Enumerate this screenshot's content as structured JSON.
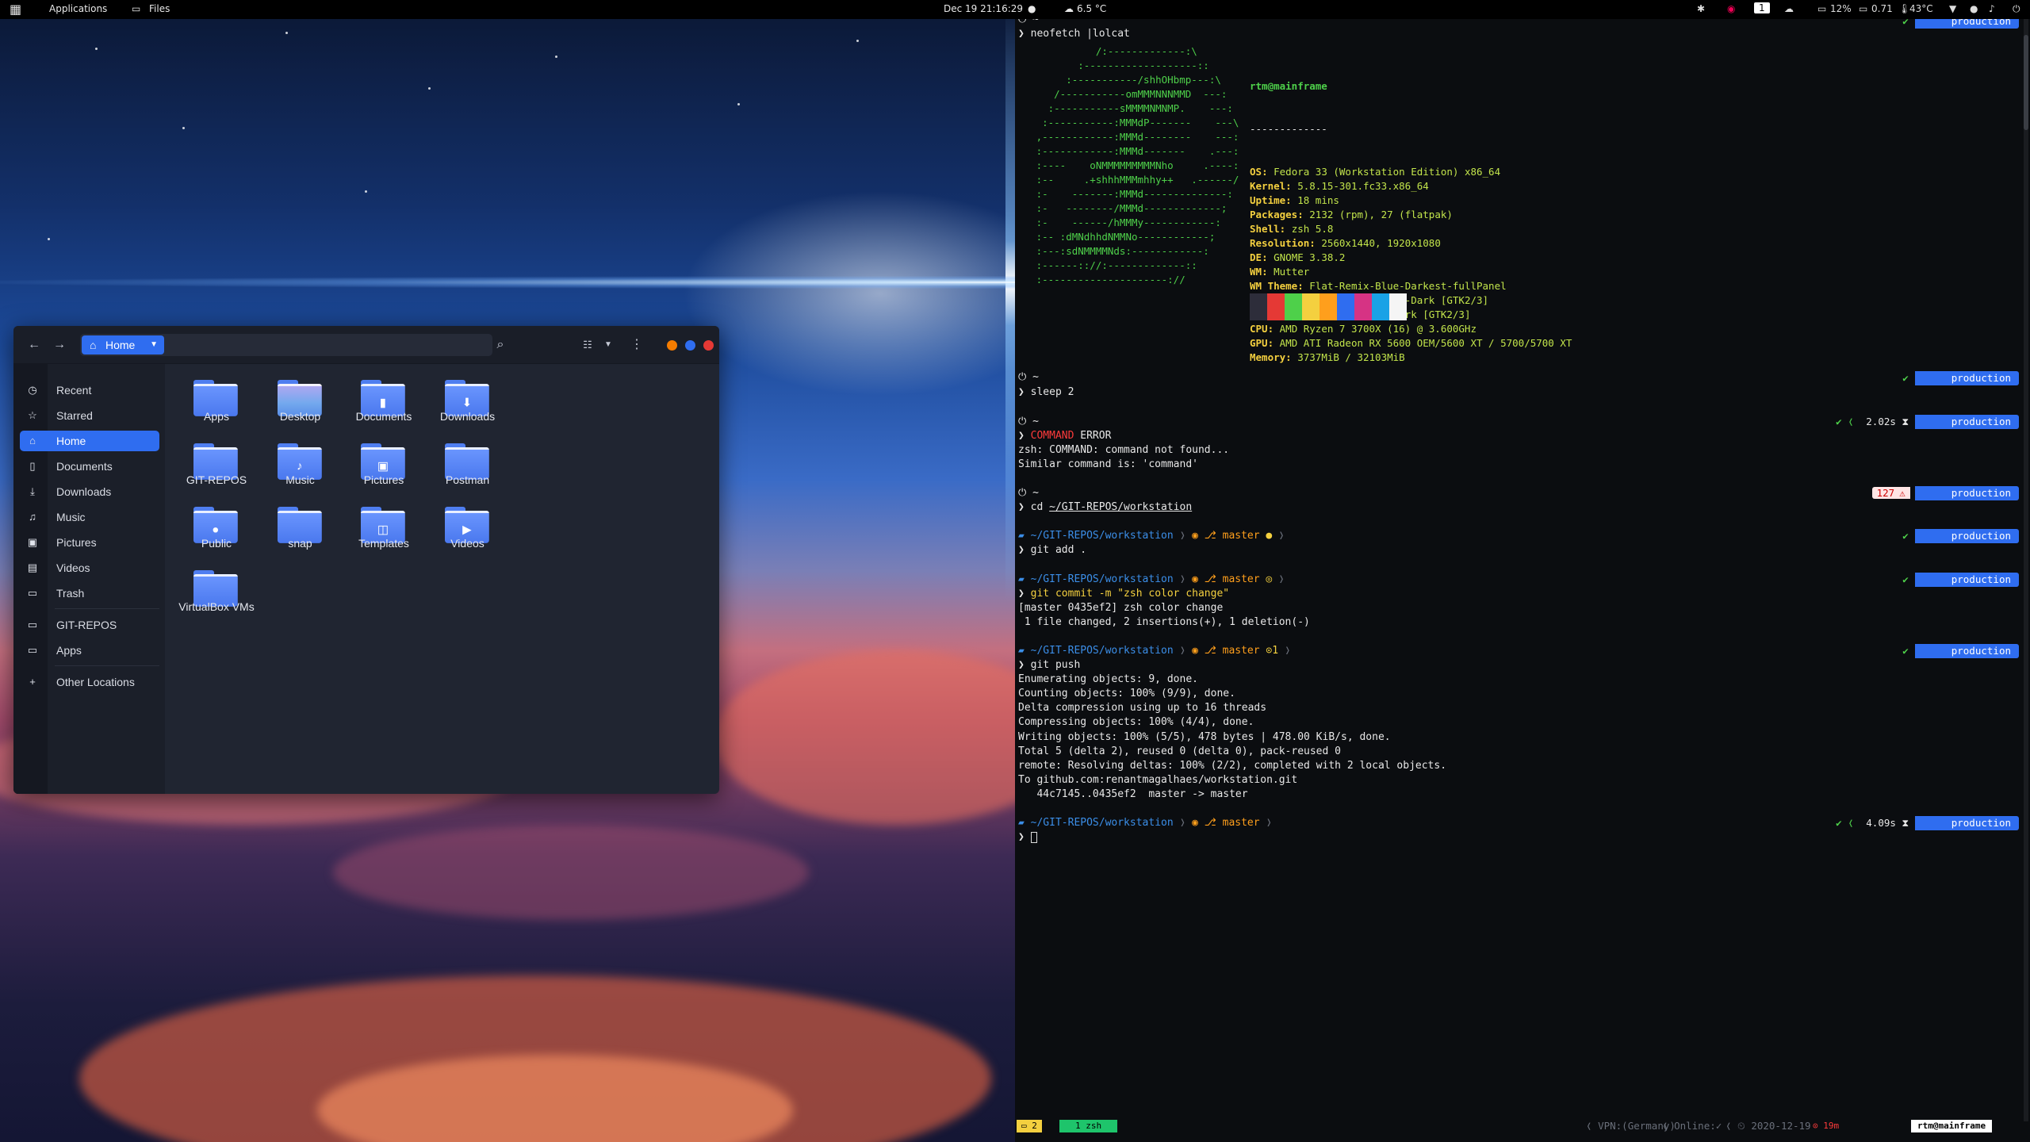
{
  "topbar": {
    "applications": "Applications",
    "files": "Files",
    "clock": "Dec 19  21:16:29",
    "weather": "6.5 °C",
    "workspace": "1",
    "cpu": "12%",
    "load": "0.71",
    "temp": "43°C"
  },
  "filemanager": {
    "path": "Home",
    "sidebar": [
      {
        "label": "Recent",
        "icon": "clock-icon"
      },
      {
        "label": "Starred",
        "icon": "star-icon"
      },
      {
        "label": "Home",
        "icon": "home-icon"
      },
      {
        "label": "Documents",
        "icon": "document-icon"
      },
      {
        "label": "Downloads",
        "icon": "download-icon"
      },
      {
        "label": "Music",
        "icon": "music-icon"
      },
      {
        "label": "Pictures",
        "icon": "picture-icon"
      },
      {
        "label": "Videos",
        "icon": "video-icon"
      },
      {
        "label": "Trash",
        "icon": "trash-icon"
      },
      {
        "label": "GIT-REPOS",
        "icon": "folder-icon"
      },
      {
        "label": "Apps",
        "icon": "folder-icon"
      },
      {
        "label": "Other Locations",
        "icon": "plus-icon"
      }
    ],
    "folders": [
      {
        "name": "Apps",
        "glyph": ""
      },
      {
        "name": "Desktop",
        "glyph": ""
      },
      {
        "name": "Documents",
        "glyph": "▮"
      },
      {
        "name": "Downloads",
        "glyph": "⬇"
      },
      {
        "name": "GIT-REPOS",
        "glyph": ""
      },
      {
        "name": "Music",
        "glyph": "♪"
      },
      {
        "name": "Pictures",
        "glyph": "▣"
      },
      {
        "name": "Postman",
        "glyph": ""
      },
      {
        "name": "Public",
        "glyph": "●"
      },
      {
        "name": "snap",
        "glyph": ""
      },
      {
        "name": "Templates",
        "glyph": "◫"
      },
      {
        "name": "Videos",
        "glyph": "▶"
      },
      {
        "name": "VirtualBox VMs",
        "glyph": ""
      }
    ]
  },
  "terminal": {
    "cmd_neofetch": "neofetch |lolcat",
    "user_host": "rtm@mainframe",
    "dashes": "-------------",
    "info": [
      {
        "k": "OS",
        "v": "Fedora 33 (Workstation Edition) x86_64"
      },
      {
        "k": "Kernel",
        "v": "5.8.15-301.fc33.x86_64"
      },
      {
        "k": "Uptime",
        "v": "18 mins"
      },
      {
        "k": "Packages",
        "v": "2132 (rpm), 27 (flatpak)"
      },
      {
        "k": "Shell",
        "v": "zsh 5.8"
      },
      {
        "k": "Resolution",
        "v": "2560x1440, 1920x1080"
      },
      {
        "k": "DE",
        "v": "GNOME 3.38.2"
      },
      {
        "k": "WM",
        "v": "Mutter"
      },
      {
        "k": "WM Theme",
        "v": "Flat-Remix-Blue-Darkest-fullPanel"
      },
      {
        "k": "Theme",
        "v": "Flat-Remix-GTK-Blue-Dark [GTK2/3]"
      },
      {
        "k": "Icons",
        "v": "Tela-circle-blue-dark [GTK2/3]"
      },
      {
        "k": "CPU",
        "v": "AMD Ryzen 7 3700X (16) @ 3.600GHz"
      },
      {
        "k": "GPU",
        "v": "AMD ATI Radeon RX 5600 OEM/5600 XT / 5700/5700 XT"
      },
      {
        "k": "Memory",
        "v": "3737MiB / 32103MiB"
      }
    ],
    "cmd_sleep": "sleep 2",
    "cmd_error": "COMMAND",
    "cmd_error_arg": "ERROR",
    "err1": "zsh: COMMAND: command not found...",
    "err2": "Similar command is: 'command'",
    "cmd_cd": "cd",
    "cd_path": "~/GIT-REPOS/workstation",
    "repo_path": "~/GIT-REPOS/workstation",
    "branch": "master",
    "cmd_add": "git add .",
    "cmd_commit": "git commit -m \"zsh color change\"",
    "commit1": "[master 0435ef2] zsh color change",
    "commit2": " 1 file changed, 2 insertions(+), 1 deletion(-)",
    "cmd_push": "git push",
    "push": [
      "Enumerating objects: 9, done.",
      "Counting objects: 100% (9/9), done.",
      "Delta compression using up to 16 threads",
      "Compressing objects: 100% (4/4), done.",
      "Writing objects: 100% (5/5), 478 bytes | 478.00 KiB/s, done.",
      "Total 5 (delta 2), reused 0 (delta 0), pack-reused 0",
      "remote: Resolving deltas: 100% (2/2), completed with 2 local objects.",
      "To github.com:renantmagalhaes/workstation.git",
      "   44c7145..0435ef2  master -> master"
    ],
    "context": "production",
    "time1": "2.02s",
    "err_code": "127",
    "ahead": "1",
    "time2": "4.09s",
    "status": {
      "session": "2",
      "window": "1 zsh",
      "vpn": "VPN:(Germany)",
      "online": "Online:",
      "date": "2020-12-19",
      "uptime": "19m",
      "host": "rtm@mainframe"
    }
  },
  "colors": {
    "accent": "#2f6df0",
    "close": "#e53935",
    "minimize": "#f57c00",
    "maximize": "#2f6df0",
    "palette": [
      "#2d2d3a",
      "#e53935",
      "#4ed04a",
      "#f4d03f",
      "#ff9f1c",
      "#2f6df0",
      "#d63384",
      "#19a2e6",
      "#f5f5f5"
    ]
  }
}
